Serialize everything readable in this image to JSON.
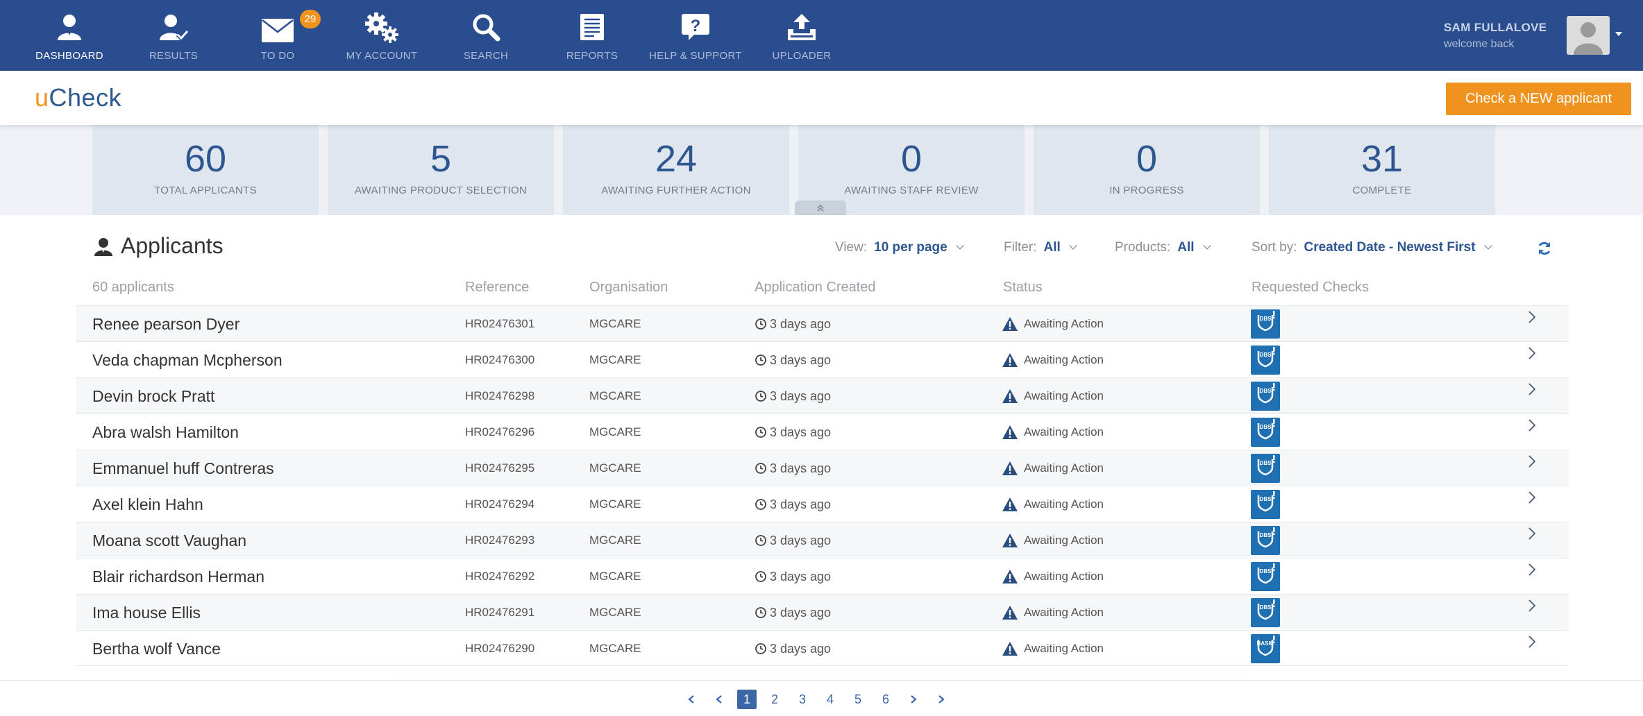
{
  "nav": {
    "items": [
      {
        "label": "DASHBOARD",
        "icon": "user-icon"
      },
      {
        "label": "RESULTS",
        "icon": "user-check-icon"
      },
      {
        "label": "TO DO",
        "icon": "envelope-icon",
        "badge": "29"
      },
      {
        "label": "MY ACCOUNT",
        "icon": "gears-icon"
      },
      {
        "label": "SEARCH",
        "icon": "search-icon"
      },
      {
        "label": "REPORTS",
        "icon": "document-icon"
      },
      {
        "label": "HELP & SUPPORT",
        "icon": "help-icon"
      },
      {
        "label": "UPLOADER",
        "icon": "upload-icon"
      }
    ],
    "user_name": "SAM FULLALOVE",
    "user_welcome": "welcome back"
  },
  "brand": {
    "logo_prefix": "u",
    "logo_rest": "Check",
    "cta_label": "Check a NEW applicant"
  },
  "stats": [
    {
      "value": "60",
      "label": "TOTAL APPLICANTS"
    },
    {
      "value": "5",
      "label": "AWAITING PRODUCT SELECTION"
    },
    {
      "value": "24",
      "label": "AWAITING FURTHER ACTION"
    },
    {
      "value": "0",
      "label": "AWAITING STAFF REVIEW"
    },
    {
      "value": "0",
      "label": "IN PROGRESS"
    },
    {
      "value": "31",
      "label": "COMPLETE"
    }
  ],
  "applicants": {
    "title": "Applicants",
    "count_label": "60 applicants",
    "view_label": "View:",
    "view_value": "10 per page",
    "filter_label": "Filter:",
    "filter_value": "All",
    "products_label": "Products:",
    "products_value": "All",
    "sort_label": "Sort by:",
    "sort_value": "Created Date - Newest First",
    "columns": {
      "reference": "Reference",
      "organisation": "Organisation",
      "created": "Application Created",
      "status": "Status",
      "checks": "Requested Checks"
    },
    "rows": [
      {
        "name": "Renee pearson Dyer",
        "ref": "HR02476301",
        "org": "MGCARE",
        "created": "3 days ago",
        "status": "Awaiting Action",
        "check": "DBS"
      },
      {
        "name": "Veda chapman Mcpherson",
        "ref": "HR02476300",
        "org": "MGCARE",
        "created": "3 days ago",
        "status": "Awaiting Action",
        "check": "DBS"
      },
      {
        "name": "Devin brock Pratt",
        "ref": "HR02476298",
        "org": "MGCARE",
        "created": "3 days ago",
        "status": "Awaiting Action",
        "check": "DBS"
      },
      {
        "name": "Abra walsh Hamilton",
        "ref": "HR02476296",
        "org": "MGCARE",
        "created": "3 days ago",
        "status": "Awaiting Action",
        "check": "DBS"
      },
      {
        "name": "Emmanuel huff Contreras",
        "ref": "HR02476295",
        "org": "MGCARE",
        "created": "3 days ago",
        "status": "Awaiting Action",
        "check": "DBS"
      },
      {
        "name": "Axel klein Hahn",
        "ref": "HR02476294",
        "org": "MGCARE",
        "created": "3 days ago",
        "status": "Awaiting Action",
        "check": "DBS"
      },
      {
        "name": "Moana scott Vaughan",
        "ref": "HR02476293",
        "org": "MGCARE",
        "created": "3 days ago",
        "status": "Awaiting Action",
        "check": "DBS"
      },
      {
        "name": "Blair richardson Herman",
        "ref": "HR02476292",
        "org": "MGCARE",
        "created": "3 days ago",
        "status": "Awaiting Action",
        "check": "DBS"
      },
      {
        "name": "Ima house Ellis",
        "ref": "HR02476291",
        "org": "MGCARE",
        "created": "3 days ago",
        "status": "Awaiting Action",
        "check": "DBS"
      },
      {
        "name": "Bertha wolf Vance",
        "ref": "HR02476290",
        "org": "MGCARE",
        "created": "3 days ago",
        "status": "Awaiting Action",
        "check": "BASIC"
      }
    ]
  },
  "pagination": {
    "pages": [
      "1",
      "2",
      "3",
      "4",
      "5",
      "6"
    ],
    "current": "1"
  },
  "colors": {
    "nav_bg": "#2a4d8f",
    "accent": "#f0921e",
    "brand_blue": "#2d5590",
    "dbs_blue": "#1f6fb3"
  }
}
